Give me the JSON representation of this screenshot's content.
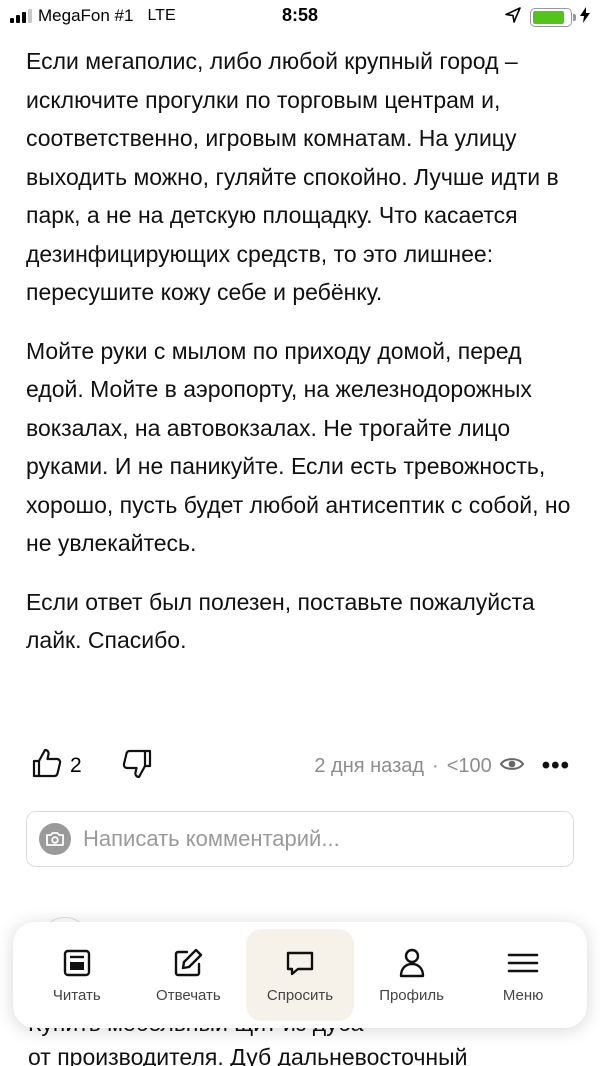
{
  "status_bar": {
    "carrier": "MegaFon #1",
    "network": "LTE",
    "time": "8:58",
    "battery_fraction": 0.85
  },
  "article": {
    "paragraphs": [
      "Если мегаполис, либо любой крупный город – исключите прогулки по торговым центрам и, соответственно, игровым комнатам. На улицу выходить можно, гуляйте спокойно. Лучше идти в парк, а не на детскую площадку. Что касается дезинфицирующих средств, то это лишнее: пересушите кожу себе и ребёнку.",
      "Мойте руки с мылом по приходу домой, перед едой. Мойте в аэропорту, на железнодорожных вокзалах, на автовокзалах. Не трогайте лицо руками. И не паникуйте. Если есть тревожность, хорошо, пусть будет любой антисептик с собой, но не увлекайтесь.",
      "Если ответ был полезен, поставьте пожалуйста лайк. Спасибо."
    ]
  },
  "actions": {
    "like_count": "2",
    "time_ago": "2 дня назад",
    "separator": "·",
    "views": "<100"
  },
  "comment": {
    "placeholder": "Написать комментарий..."
  },
  "next_content": {
    "line1": "Купить мебельный щит из дуба",
    "line2": "от производителя. Дуб дальневосточный"
  },
  "bottom_nav": {
    "items": [
      {
        "label": "Читать",
        "icon": "read-icon"
      },
      {
        "label": "Отвечать",
        "icon": "edit-icon"
      },
      {
        "label": "Спросить",
        "icon": "chat-bubble-icon",
        "active": true
      },
      {
        "label": "Профиль",
        "icon": "profile-icon"
      },
      {
        "label": "Меню",
        "icon": "menu-icon"
      }
    ]
  },
  "colors": {
    "active_tab_bg": "#f6f1e9",
    "battery_green": "#52c41a",
    "muted_text": "#8d8d8d"
  }
}
